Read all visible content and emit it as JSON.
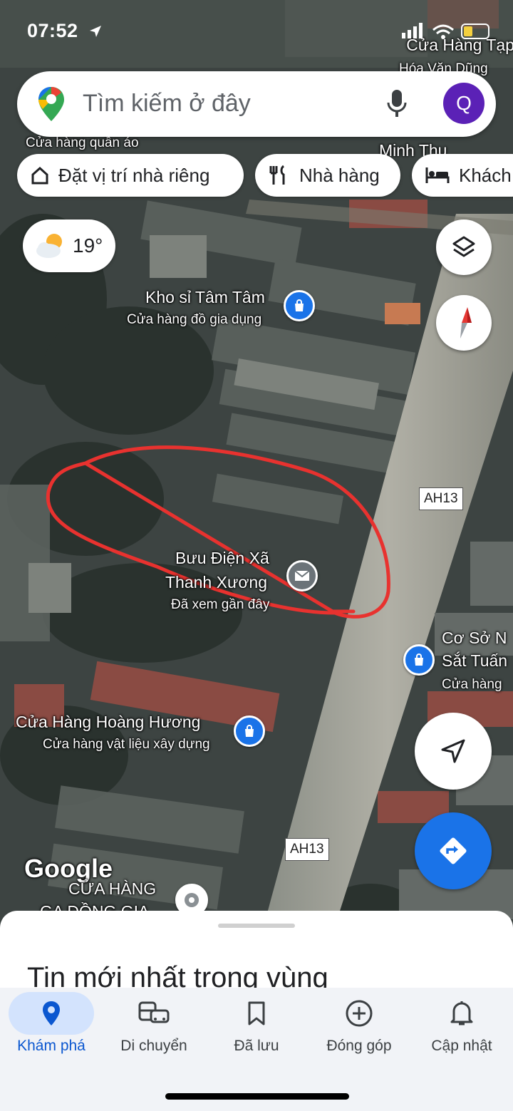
{
  "status_bar": {
    "time": "07:52"
  },
  "search": {
    "placeholder": "Tìm kiếm ở đây",
    "avatar_letter": "Q"
  },
  "chips": [
    {
      "label": "Đặt vị trí nhà riêng",
      "icon": "home-icon"
    },
    {
      "label": "Nhà hàng",
      "icon": "restaurant-icon"
    },
    {
      "label": "Khách",
      "icon": "hotel-icon"
    }
  ],
  "weather": {
    "temp": "19°",
    "icon": "partly-cloudy-icon"
  },
  "map_labels": {
    "cua_hang_tap_hoa_1": "Cửa Hàng Tạp",
    "cua_hang_tap_hoa_2": "Hóa Văn Dũng",
    "cua_hang_quan_ao": "Cửa hàng quần áo",
    "minh_thu": "Minh Thu",
    "kho_si_name": "Kho sỉ Tâm Tâm",
    "kho_si_sub": "Cửa hàng đồ gia dụng",
    "buu_dien_1": "Bưu Điện Xã",
    "buu_dien_2": "Thanh Xương",
    "buu_dien_sub": "Đã xem gần đây",
    "co_so_1": "Cơ Sở N",
    "co_so_2": "Sắt Tuấn",
    "co_so_sub": "Cửa hàng",
    "hoang_huong_name": "Cửa Hàng Hoàng Hương",
    "hoang_huong_sub": "Cửa hàng vật liệu xây dựng",
    "cua_hang_bottom": "CỬA HÀNG",
    "ga_dong_gia": "GA ĐỒNG GIA",
    "road_1": "AH13",
    "road_2": "AH13",
    "google": "Google"
  },
  "sheet": {
    "title": "Tin mới nhất trong vùng"
  },
  "nav": [
    {
      "label": "Khám phá",
      "icon": "explore-pin-icon",
      "active": true
    },
    {
      "label": "Di chuyển",
      "icon": "commute-icon",
      "active": false
    },
    {
      "label": "Đã lưu",
      "icon": "bookmark-icon",
      "active": false
    },
    {
      "label": "Đóng góp",
      "icon": "add-circle-icon",
      "active": false
    },
    {
      "label": "Cập nhật",
      "icon": "bell-icon",
      "active": false
    }
  ],
  "colors": {
    "accent": "#1a73e8",
    "active_nav_bg": "#d3e3fd",
    "annotation": "#e8322f"
  }
}
